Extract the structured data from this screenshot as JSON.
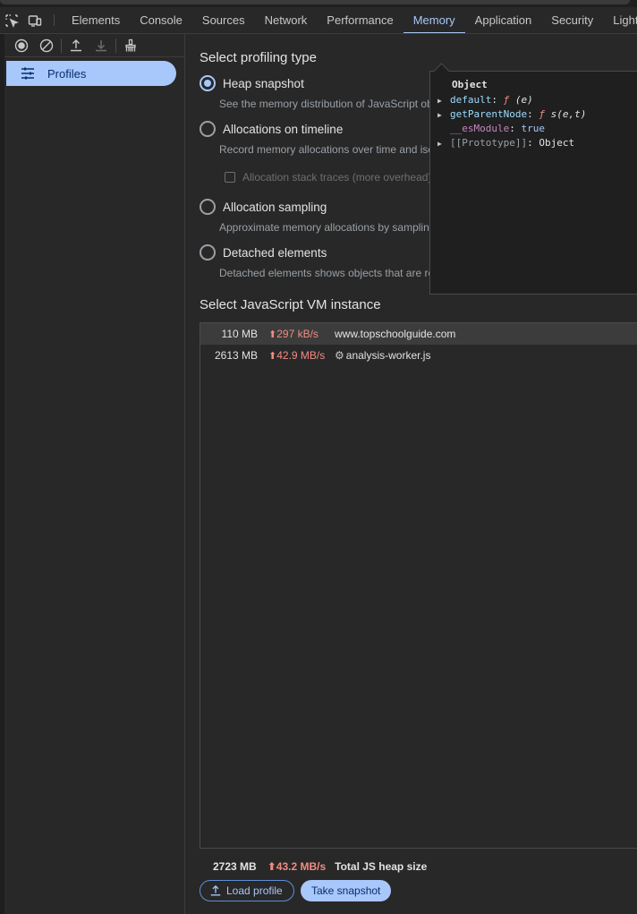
{
  "tabs": [
    {
      "label": "Elements",
      "active": false
    },
    {
      "label": "Console",
      "active": false
    },
    {
      "label": "Sources",
      "active": false
    },
    {
      "label": "Network",
      "active": false
    },
    {
      "label": "Performance",
      "active": false
    },
    {
      "label": "Memory",
      "active": true
    },
    {
      "label": "Application",
      "active": false
    },
    {
      "label": "Security",
      "active": false
    },
    {
      "label": "Lighthouse",
      "active": false
    }
  ],
  "sidebar": {
    "profiles_label": "Profiles"
  },
  "profiling": {
    "title": "Select profiling type",
    "options": [
      {
        "label": "Heap snapshot",
        "desc": "See the memory distribution of JavaScript objects and related DOM nodes",
        "checked": true
      },
      {
        "label": "Allocations on timeline",
        "desc": "Record memory allocations over time and isolate memory leaks"
      },
      {
        "label": "Allocation sampling",
        "desc": "Approximate memory allocations by sampling long operations"
      },
      {
        "label": "Detached elements",
        "desc": "Detached elements shows objects that are retained by a JS reference"
      }
    ],
    "stack_traces_label": "Allocation stack traces (more overhead)"
  },
  "vm": {
    "title": "Select JavaScript VM instance",
    "rows": [
      {
        "size": "110 MB",
        "rate": "297 kB/s",
        "name": "www.topschoolguide.com",
        "selected": true
      },
      {
        "size": "2613 MB",
        "rate": "42.9 MB/s",
        "name": "analysis-worker.js",
        "selected": false
      }
    ]
  },
  "footer": {
    "total_size": "2723 MB",
    "total_rate": "43.2 MB/s",
    "total_label": "Total JS heap size",
    "load_label": "Load profile",
    "snapshot_label": "Take snapshot"
  },
  "popover": {
    "title": "Object",
    "k_default": "default",
    "v_default_fn": "ƒ",
    "v_default_sig": "(e)",
    "k_parent": "getParentNode",
    "v_parent_fn": "ƒ",
    "v_parent_sig": "s(e,t)",
    "k_es": "__esModule",
    "v_es": "true",
    "k_proto": "[[Prototype]]",
    "v_proto": "Object"
  },
  "colors": {
    "accent": "#a8c7fa",
    "rate": "#f28b82",
    "background": "#282828"
  }
}
